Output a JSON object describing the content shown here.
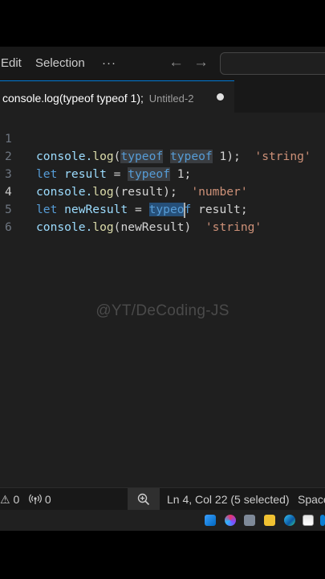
{
  "menu": {
    "edit": "Edit",
    "selection": "Selection",
    "more": "···"
  },
  "nav": {
    "back": "←",
    "forward": "→"
  },
  "tab": {
    "title": "console.log(typeof typeof 1);",
    "description": "Untitled-2"
  },
  "editor": {
    "line_numbers": [
      "1",
      "2",
      "3",
      "4",
      "5",
      "6"
    ],
    "active_line": 4,
    "line1": {
      "code_a": "console.",
      "fn": "log",
      "paren_open": "(",
      "kw1": "typeof",
      "space": " ",
      "kw2": "typeof",
      "rest": " 1);  ",
      "comment": "'string'"
    },
    "line2": {
      "kw": "let",
      "var": " result",
      "mid": " = ",
      "kw2": "typeof",
      "rest": " 1;"
    },
    "line3": {
      "code_a": "console.",
      "fn": "log",
      "rest": "(result);  ",
      "comment": "'number'"
    },
    "line4": {
      "kw": "let",
      "var": " newResult",
      "mid": " = ",
      "sel": "typeo",
      "after": "f",
      "rest": " result;"
    },
    "line5": {
      "code_a": "console.",
      "fn": "log",
      "rest": "(newResult)  ",
      "comment": "'string'"
    }
  },
  "watermark": "@YT/DeCoding-JS",
  "status": {
    "errors": "⚠ 0",
    "ports": "0",
    "cursor_position": "Ln 4, Col 22 (5 selected)",
    "spaces": "Spaces"
  },
  "colors": {
    "accent": "#0078d4",
    "selection": "#264f78",
    "editor_bg": "#1f1f1f"
  }
}
